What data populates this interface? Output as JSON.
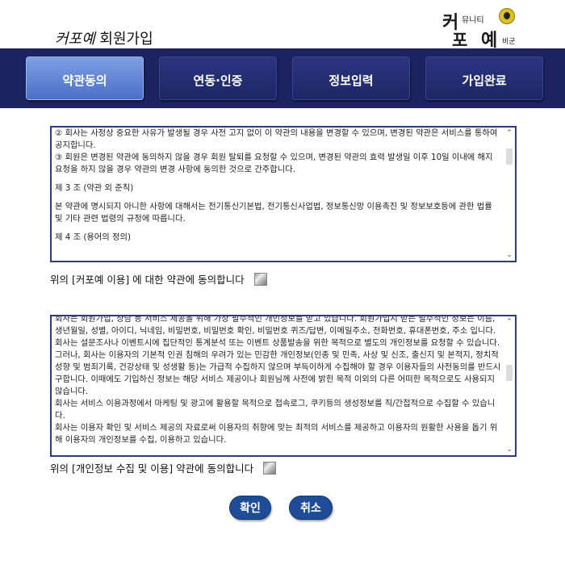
{
  "header": {
    "title_brand": "커포예",
    "title_rest": " 회원가입",
    "logo": {
      "line1": "커",
      "line1_small": "뮤니티",
      "line2a": "포",
      "line2b": "예",
      "line2_small": "비군"
    }
  },
  "steps": [
    {
      "label": "약관동의",
      "active": true
    },
    {
      "label": "연동·인증",
      "active": false
    },
    {
      "label": "정보입력",
      "active": false
    },
    {
      "label": "가입완료",
      "active": false
    }
  ],
  "terms1": {
    "paragraphs": [
      {
        "text": "② 회사는 사정상 중요한 사유가 발생될 경우 사전 고지 없이 이 약관의 내용을 변경할 수 있으며, 변경된 약관은 서비스를 통하여 공지합니다.",
        "gap": false
      },
      {
        "text": "③ 회원은 변경된 약관에 동의하지 않을 경우 회원 탈퇴를 요청할 수 있으며, 변경된 약관의 효력 발생일 이후 10일 이내에 해지 요청을 하지 않을 경우 약관의 변경 사항에 동의한 것으로 간주합니다.",
        "gap": false
      },
      {
        "text": "제 3 조 (약관 외 준칙)",
        "gap": true
      },
      {
        "text": "본 약관에 명시되지 아니한 사항에 대해서는 전기통신기본법, 전기통신사업법, 정보통신망 이용촉진 및 정보보호등에 관한 법률 및 기타 관련 법령의 규정에 따릅니다.",
        "gap": true
      },
      {
        "text": "제 4 조 (용어의 정의)",
        "gap": true
      }
    ],
    "agree_label": "위의 [커포예 이용] 에 대한 약관에 동의합니다"
  },
  "terms2": {
    "paragraphs": [
      {
        "text": " 회사는 회원가입, 상담 등 서비스 제공을 위해 가장 필수적인 개인정보를 받고 있습니다. 회원가입시 받는 필수적인 정보는 이름, 생년월일, 성별, 아이디, 닉네임, 비밀번호, 비밀번호 확인, 비밀번호 퀴즈/답변, 이메일주소, 전화번호, 휴대폰번호, 주소 입니다."
      },
      {
        "text": " 회사는 설문조사나 이벤트시에 집단적인 통계분석 또는 이벤트 상품발송을 위한 목적으로 별도의 개인정보를 요청할 수 있습니다. 그러나, 회사는 이용자의 기본적 인권 침해의 우려가 있는 민감한 개인정보(인종 및 민족, 사상 및 신조, 출신지 및 본적지, 정치적 성향 및 범죄기록, 건강상태 및 성생활 등)는 가급적 수집하지 않으며 부득이하게 수집해야 할 경우 이용자들의 사전동의를 반드시 구합니다. 이때에도 기입하신 정보는 해당 서비스 제공이나 회원님께 사전에 밝힌 목적 이외의 다른 어떠한 목적으로도 사용되지 않습니다."
      },
      {
        "text": " 회사는 서비스 이용과정에서 마케팅 및 광고에 활용할 목적으로 접속로그, 쿠키등의 생성정보를 직/간접적으로 수집할 수 있습니다."
      },
      {
        "text": " 회사는 이용자 확인 및 서비스 제공의 자료로써 이용자의 취향에 맞는 최적의 서비스를 제공하고 이용자의 원활한 사용을 돕기 위해 이용자의 개인정보를 수집, 이용하고 있습니다."
      }
    ],
    "agree_label": "위의 [개인정보 수집 및 이용]  약관에 동의합니다"
  },
  "buttons": {
    "confirm": "확인",
    "cancel": "취소"
  }
}
